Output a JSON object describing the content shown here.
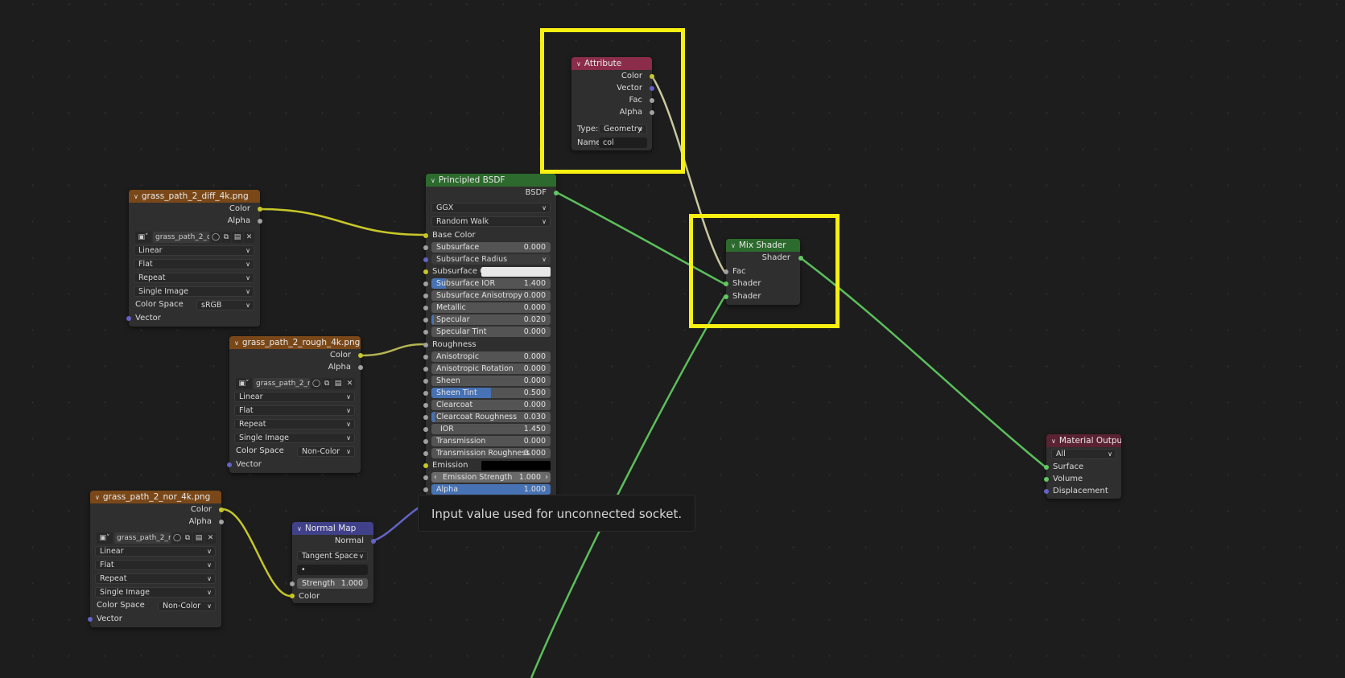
{
  "tooltip": "Input value used for unconnected socket.",
  "nodes": {
    "diff": {
      "title": "grass_path_2_diff_4k.png",
      "outputs": [
        "Color",
        "Alpha"
      ],
      "image_name": "grass_path_2_di...",
      "interpolation": "Linear",
      "projection": "Flat",
      "extension": "Repeat",
      "source": "Single Image",
      "color_space_label": "Color Space",
      "color_space": "sRGB",
      "input": "Vector"
    },
    "rough": {
      "title": "grass_path_2_rough_4k.png",
      "outputs": [
        "Color",
        "Alpha"
      ],
      "image_name": "grass_path_2_ro...",
      "interpolation": "Linear",
      "projection": "Flat",
      "extension": "Repeat",
      "source": "Single Image",
      "color_space_label": "Color Space",
      "color_space": "Non-Color",
      "input": "Vector"
    },
    "nor": {
      "title": "grass_path_2_nor_4k.png",
      "outputs": [
        "Color",
        "Alpha"
      ],
      "image_name": "grass_path_2_n...",
      "interpolation": "Linear",
      "projection": "Flat",
      "extension": "Repeat",
      "source": "Single Image",
      "color_space_label": "Color Space",
      "color_space": "Non-Color",
      "input": "Vector"
    },
    "normal_map": {
      "title": "Normal Map",
      "output": "Normal",
      "space": "Tangent Space",
      "uv_map": "•",
      "strength_label": "Strength",
      "strength": "1.000",
      "input": "Color"
    },
    "attribute": {
      "title": "Attribute",
      "outputs": [
        "Color",
        "Vector",
        "Fac",
        "Alpha"
      ],
      "type_label": "Type:",
      "type": "Geometry",
      "name_label": "Name:",
      "name": "col"
    },
    "bsdf": {
      "title": "Principled BSDF",
      "output": "BSDF",
      "distribution": "GGX",
      "subsurface_method": "Random Walk",
      "base_color": "Base Color",
      "subsurface": {
        "label": "Subsurface",
        "value": "0.000"
      },
      "subsurface_radius": "Subsurface Radius",
      "subsurface_color": "Subsurface C...",
      "subsurface_ior": {
        "label": "Subsurface IOR",
        "value": "1.400"
      },
      "subsurface_anisotropy": {
        "label": "Subsurface Anisotropy",
        "value": "0.000"
      },
      "metallic": {
        "label": "Metallic",
        "value": "0.000"
      },
      "specular": {
        "label": "Specular",
        "value": "0.020"
      },
      "specular_tint": {
        "label": "Specular Tint",
        "value": "0.000"
      },
      "roughness": "Roughness",
      "anisotropic": {
        "label": "Anisotropic",
        "value": "0.000"
      },
      "anisotropic_rotation": {
        "label": "Anisotropic Rotation",
        "value": "0.000"
      },
      "sheen": {
        "label": "Sheen",
        "value": "0.000"
      },
      "sheen_tint": {
        "label": "Sheen Tint",
        "value": "0.500"
      },
      "clearcoat": {
        "label": "Clearcoat",
        "value": "0.000"
      },
      "clearcoat_roughness": {
        "label": "Clearcoat Roughness",
        "value": "0.030"
      },
      "ior": {
        "label": "IOR",
        "value": "1.450"
      },
      "transmission": {
        "label": "Transmission",
        "value": "0.000"
      },
      "transmission_roughness": {
        "label": "Transmission Roughness",
        "value": "0.000"
      },
      "emission": "Emission",
      "emission_strength": {
        "label": "Emission Strength",
        "value": "1.000"
      },
      "alpha": {
        "label": "Alpha",
        "value": "1.000"
      }
    },
    "mix": {
      "title": "Mix Shader",
      "output": "Shader",
      "inputs": [
        "Fac",
        "Shader",
        "Shader"
      ]
    },
    "output": {
      "title": "Material Output",
      "target": "All",
      "inputs": [
        "Surface",
        "Volume",
        "Displacement"
      ]
    }
  },
  "colors": {
    "highlight": "#f7f011",
    "texture_header": "#7a4818",
    "shader_header": "#2d6a2d",
    "attribute_header": "#8b2d4a",
    "vector_header": "#41418a",
    "output_header": "#5a2233",
    "field_fill": "#4772b3"
  }
}
